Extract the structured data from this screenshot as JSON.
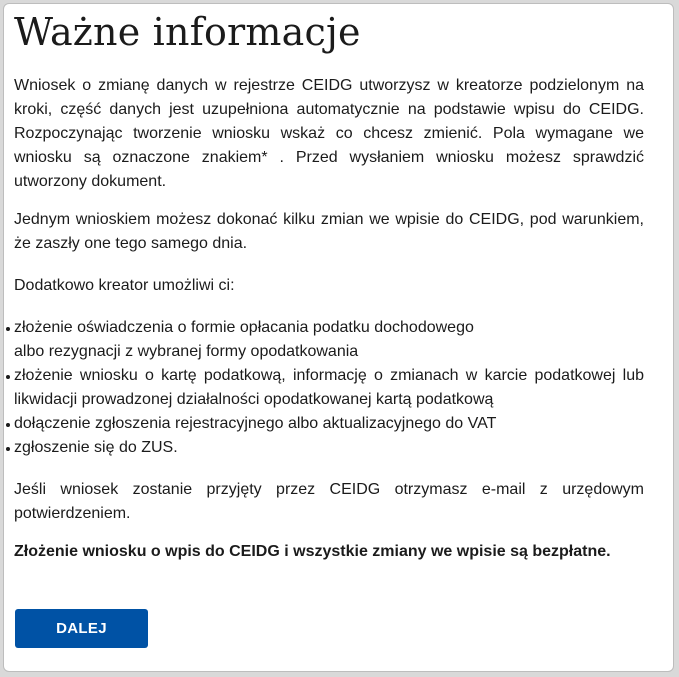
{
  "title": "Ważne informacje",
  "paragraphs": {
    "intro": "Wniosek o zmianę danych w rejestrze CEIDG utworzysz w kreatorze podzielonym na kroki, część danych jest uzupełniona automatycznie na podstawie wpisu do CEIDG. Rozpoczynając tworzenie wniosku wskaż co chcesz zmienić. Pola wymagane we wniosku są oznaczone znakiem* . Przed wysłaniem wniosku możesz sprawdzić utworzony dokument.",
    "single": "Jednym wnioskiem możesz dokonać kilku zmian we wpisie do CEIDG, pod warunkiem, że zaszły one tego samego dnia.",
    "additional": "Dodatkowo kreator umożliwi ci:",
    "email": "Jeśli wniosek zostanie przyjęty przez CEIDG otrzymasz e-mail z urzędowym potwierdzeniem.",
    "free": "Złożenie wniosku o wpis do CEIDG i wszystkie zmiany we wpisie są bezpłatne."
  },
  "list": [
    "złożenie oświadczenia o formie opłacania podatku dochodowego albo rezygnacji z wybranej formy opodatkowania",
    "złożenie wniosku o kartę podatkową, informację o zmianach w karcie podatkowej lub likwidacji prowadzonej działalności opodatkowanej kartą podatkową",
    "dołączenie zgłoszenia rejestracyjnego albo aktualizacyjnego do VAT",
    "zgłoszenie się do ZUS."
  ],
  "button": {
    "label": "DALEJ",
    "color": "#0052a5"
  }
}
